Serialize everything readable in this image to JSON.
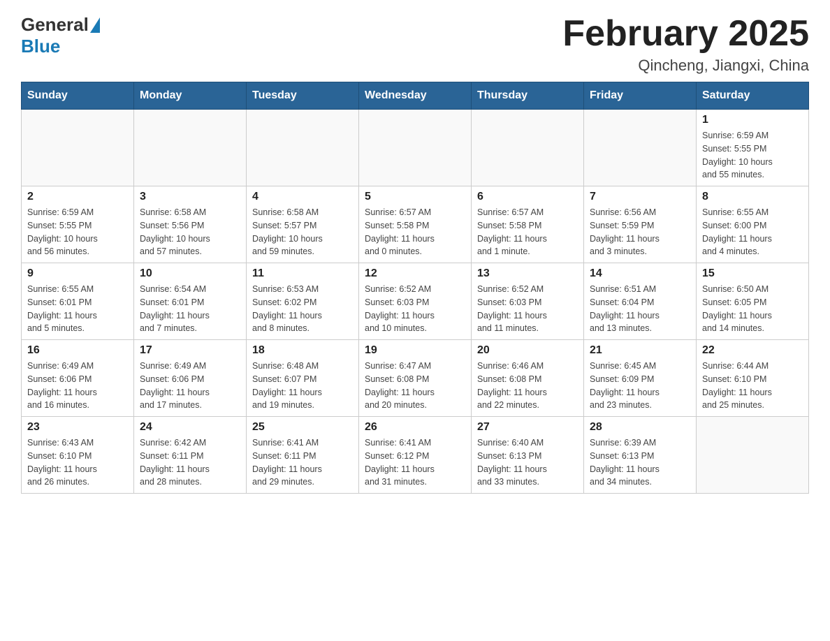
{
  "header": {
    "logo_general": "General",
    "logo_blue": "Blue",
    "month_title": "February 2025",
    "location": "Qincheng, Jiangxi, China"
  },
  "weekdays": [
    "Sunday",
    "Monday",
    "Tuesday",
    "Wednesday",
    "Thursday",
    "Friday",
    "Saturday"
  ],
  "weeks": [
    [
      {
        "day": "",
        "info": ""
      },
      {
        "day": "",
        "info": ""
      },
      {
        "day": "",
        "info": ""
      },
      {
        "day": "",
        "info": ""
      },
      {
        "day": "",
        "info": ""
      },
      {
        "day": "",
        "info": ""
      },
      {
        "day": "1",
        "info": "Sunrise: 6:59 AM\nSunset: 5:55 PM\nDaylight: 10 hours\nand 55 minutes."
      }
    ],
    [
      {
        "day": "2",
        "info": "Sunrise: 6:59 AM\nSunset: 5:55 PM\nDaylight: 10 hours\nand 56 minutes."
      },
      {
        "day": "3",
        "info": "Sunrise: 6:58 AM\nSunset: 5:56 PM\nDaylight: 10 hours\nand 57 minutes."
      },
      {
        "day": "4",
        "info": "Sunrise: 6:58 AM\nSunset: 5:57 PM\nDaylight: 10 hours\nand 59 minutes."
      },
      {
        "day": "5",
        "info": "Sunrise: 6:57 AM\nSunset: 5:58 PM\nDaylight: 11 hours\nand 0 minutes."
      },
      {
        "day": "6",
        "info": "Sunrise: 6:57 AM\nSunset: 5:58 PM\nDaylight: 11 hours\nand 1 minute."
      },
      {
        "day": "7",
        "info": "Sunrise: 6:56 AM\nSunset: 5:59 PM\nDaylight: 11 hours\nand 3 minutes."
      },
      {
        "day": "8",
        "info": "Sunrise: 6:55 AM\nSunset: 6:00 PM\nDaylight: 11 hours\nand 4 minutes."
      }
    ],
    [
      {
        "day": "9",
        "info": "Sunrise: 6:55 AM\nSunset: 6:01 PM\nDaylight: 11 hours\nand 5 minutes."
      },
      {
        "day": "10",
        "info": "Sunrise: 6:54 AM\nSunset: 6:01 PM\nDaylight: 11 hours\nand 7 minutes."
      },
      {
        "day": "11",
        "info": "Sunrise: 6:53 AM\nSunset: 6:02 PM\nDaylight: 11 hours\nand 8 minutes."
      },
      {
        "day": "12",
        "info": "Sunrise: 6:52 AM\nSunset: 6:03 PM\nDaylight: 11 hours\nand 10 minutes."
      },
      {
        "day": "13",
        "info": "Sunrise: 6:52 AM\nSunset: 6:03 PM\nDaylight: 11 hours\nand 11 minutes."
      },
      {
        "day": "14",
        "info": "Sunrise: 6:51 AM\nSunset: 6:04 PM\nDaylight: 11 hours\nand 13 minutes."
      },
      {
        "day": "15",
        "info": "Sunrise: 6:50 AM\nSunset: 6:05 PM\nDaylight: 11 hours\nand 14 minutes."
      }
    ],
    [
      {
        "day": "16",
        "info": "Sunrise: 6:49 AM\nSunset: 6:06 PM\nDaylight: 11 hours\nand 16 minutes."
      },
      {
        "day": "17",
        "info": "Sunrise: 6:49 AM\nSunset: 6:06 PM\nDaylight: 11 hours\nand 17 minutes."
      },
      {
        "day": "18",
        "info": "Sunrise: 6:48 AM\nSunset: 6:07 PM\nDaylight: 11 hours\nand 19 minutes."
      },
      {
        "day": "19",
        "info": "Sunrise: 6:47 AM\nSunset: 6:08 PM\nDaylight: 11 hours\nand 20 minutes."
      },
      {
        "day": "20",
        "info": "Sunrise: 6:46 AM\nSunset: 6:08 PM\nDaylight: 11 hours\nand 22 minutes."
      },
      {
        "day": "21",
        "info": "Sunrise: 6:45 AM\nSunset: 6:09 PM\nDaylight: 11 hours\nand 23 minutes."
      },
      {
        "day": "22",
        "info": "Sunrise: 6:44 AM\nSunset: 6:10 PM\nDaylight: 11 hours\nand 25 minutes."
      }
    ],
    [
      {
        "day": "23",
        "info": "Sunrise: 6:43 AM\nSunset: 6:10 PM\nDaylight: 11 hours\nand 26 minutes."
      },
      {
        "day": "24",
        "info": "Sunrise: 6:42 AM\nSunset: 6:11 PM\nDaylight: 11 hours\nand 28 minutes."
      },
      {
        "day": "25",
        "info": "Sunrise: 6:41 AM\nSunset: 6:11 PM\nDaylight: 11 hours\nand 29 minutes."
      },
      {
        "day": "26",
        "info": "Sunrise: 6:41 AM\nSunset: 6:12 PM\nDaylight: 11 hours\nand 31 minutes."
      },
      {
        "day": "27",
        "info": "Sunrise: 6:40 AM\nSunset: 6:13 PM\nDaylight: 11 hours\nand 33 minutes."
      },
      {
        "day": "28",
        "info": "Sunrise: 6:39 AM\nSunset: 6:13 PM\nDaylight: 11 hours\nand 34 minutes."
      },
      {
        "day": "",
        "info": ""
      }
    ]
  ]
}
